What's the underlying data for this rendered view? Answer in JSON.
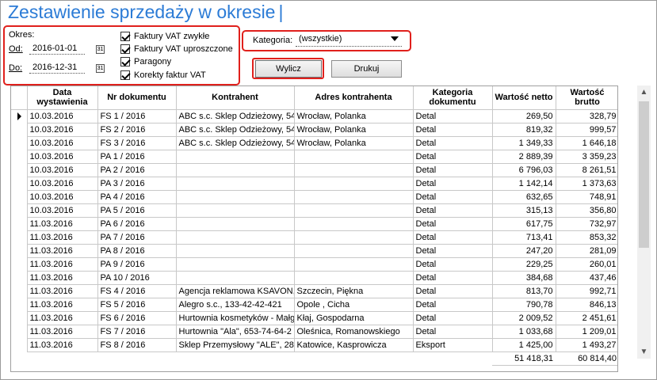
{
  "title": "Zestawienie sprzedaży w okresie",
  "filters": {
    "okres_label": "Okres:",
    "od_label": "Od:",
    "od_value": "2016-01-01",
    "do_label": "Do:",
    "do_value": "2016-12-31",
    "checkboxes": [
      {
        "label": "Faktury VAT zwykłe",
        "checked": true
      },
      {
        "label": "Faktury VAT uproszczone",
        "checked": true
      },
      {
        "label": "Paragony",
        "checked": true
      },
      {
        "label": "Korekty faktur VAT",
        "checked": true
      }
    ],
    "kategoria_label": "Kategoria:",
    "kategoria_value": "(wszystkie)"
  },
  "buttons": {
    "wylicz": "Wylicz",
    "drukuj": "Drukuj"
  },
  "table": {
    "headers": [
      "Data wystawienia",
      "Nr dokumentu",
      "Kontrahent",
      "Adres kontrahenta",
      "Kategoria dokumentu",
      "Wartość netto",
      "Wartość brutto"
    ],
    "rows": [
      [
        "10.03.2016",
        "FS 1 / 2016",
        "ABC s.c. Sklep Odzieżowy, 54",
        "Wrocław, Polanka",
        "Detal",
        "269,50",
        "328,79"
      ],
      [
        "10.03.2016",
        "FS 2 / 2016",
        "ABC s.c. Sklep Odzieżowy, 54",
        "Wrocław, Polanka",
        "Detal",
        "819,32",
        "999,57"
      ],
      [
        "10.03.2016",
        "FS 3 / 2016",
        "ABC s.c. Sklep Odzieżowy, 54",
        "Wrocław, Polanka",
        "Detal",
        "1 349,33",
        "1 646,18"
      ],
      [
        "10.03.2016",
        "PA 1 / 2016",
        "",
        "",
        "Detal",
        "2 889,39",
        "3 359,23"
      ],
      [
        "10.03.2016",
        "PA 2 / 2016",
        "",
        "",
        "Detal",
        "6 796,03",
        "8 261,51"
      ],
      [
        "10.03.2016",
        "PA 3 / 2016",
        "",
        "",
        "Detal",
        "1 142,14",
        "1 373,63"
      ],
      [
        "10.03.2016",
        "PA 4 / 2016",
        "",
        "",
        "Detal",
        "632,65",
        "748,91"
      ],
      [
        "10.03.2016",
        "PA 5 / 2016",
        "",
        "",
        "Detal",
        "315,13",
        "356,80"
      ],
      [
        "11.03.2016",
        "PA 6 / 2016",
        "",
        "",
        "Detal",
        "617,75",
        "732,97"
      ],
      [
        "11.03.2016",
        "PA 7 / 2016",
        "",
        "",
        "Detal",
        "713,41",
        "853,32"
      ],
      [
        "11.03.2016",
        "PA 8 / 2016",
        "",
        "",
        "Detal",
        "247,20",
        "281,09"
      ],
      [
        "11.03.2016",
        "PA 9 / 2016",
        "",
        "",
        "Detal",
        "229,25",
        "260,01"
      ],
      [
        "11.03.2016",
        "PA 10 / 2016",
        "",
        "",
        "Detal",
        "384,68",
        "437,46"
      ],
      [
        "11.03.2016",
        "FS 4 / 2016",
        "Agencja reklamowa KSAVON,",
        "Szczecin, Piękna",
        "Detal",
        "813,70",
        "992,71"
      ],
      [
        "11.03.2016",
        "FS 5 / 2016",
        "Alegro s.c., 133-42-42-421",
        "Opole , Cicha",
        "Detal",
        "790,78",
        "846,13"
      ],
      [
        "11.03.2016",
        "FS 6 / 2016",
        "Hurtownia kosmetyków - Małg",
        "Kłaj, Gospodarna",
        "Detal",
        "2 009,52",
        "2 451,61"
      ],
      [
        "11.03.2016",
        "FS 7 / 2016",
        "Hurtownia \"Ala\", 653-74-64-2",
        "Oleśnica, Romanowskiego",
        "Detal",
        "1 033,68",
        "1 209,01"
      ],
      [
        "11.03.2016",
        "FS 8 / 2016",
        "Sklep Przemysłowy \"ALE\", 28",
        "Katowice, Kasprowicza",
        "Eksport",
        "1 425,00",
        "1 493,27"
      ]
    ],
    "totals": {
      "netto": "51 418,31",
      "brutto": "60 814,40"
    }
  }
}
